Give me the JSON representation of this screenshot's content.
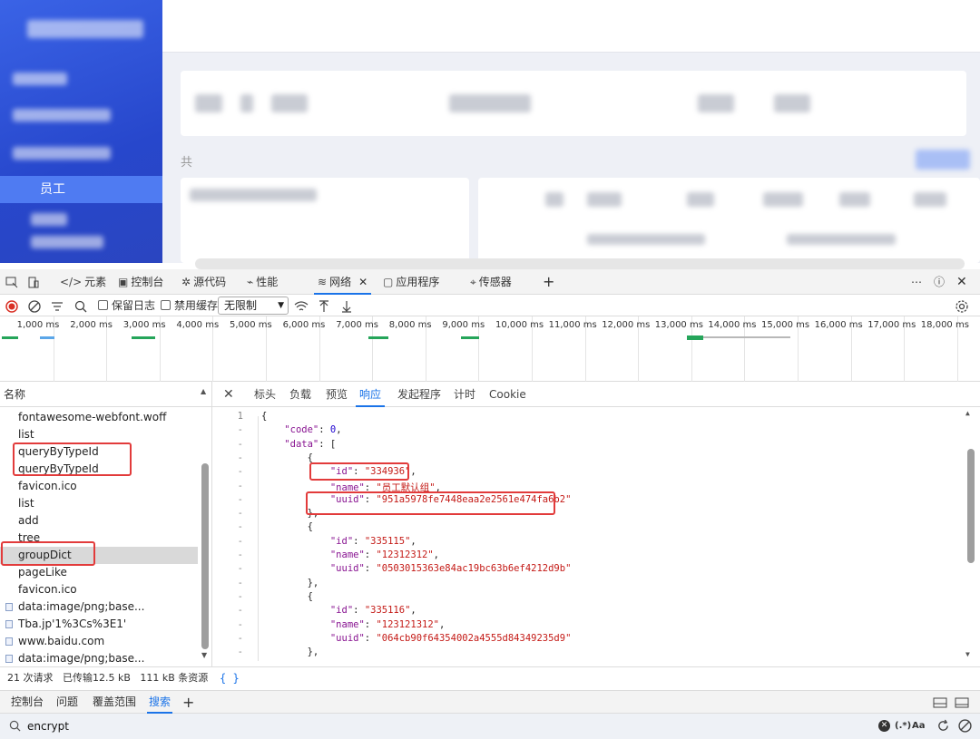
{
  "app": {
    "sidebar_active_item": "员工",
    "list_prefix": "共"
  },
  "devtools": {
    "tabs": [
      {
        "label": "元素",
        "icon": "code-icon"
      },
      {
        "label": "控制台",
        "icon": "console-icon"
      },
      {
        "label": "源代码",
        "icon": "bug-icon"
      },
      {
        "label": "性能",
        "icon": "performance-icon"
      },
      {
        "label": "网络",
        "icon": "wifi-icon"
      },
      {
        "label": "应用程序",
        "icon": "application-icon"
      },
      {
        "label": "传感器",
        "icon": "sensor-icon"
      }
    ],
    "active_tab": "网络",
    "toolbar": {
      "preserve_log": "保留日志",
      "disable_cache": "禁用缓存",
      "throttle": "无限制"
    },
    "timeline_ticks": [
      "1,000 ms",
      "2,000 ms",
      "3,000 ms",
      "4,000 ms",
      "5,000 ms",
      "6,000 ms",
      "7,000 ms",
      "8,000 ms",
      "9,000 ms",
      "10,000 ms",
      "11,000 ms",
      "12,000 ms",
      "13,000 ms",
      "14,000 ms",
      "15,000 ms",
      "16,000 ms",
      "17,000 ms",
      "18,000 ms"
    ],
    "request_list": {
      "header": "名称",
      "rows": [
        "fontawesome-webfont.woff",
        "list",
        "queryByTypeId",
        "queryByTypeId",
        "favicon.ico",
        "list",
        "add",
        "tree",
        "groupDict",
        "pageLike",
        "favicon.ico",
        "data:image/png;base...",
        "Tba.jp'1%3Cs%3E1'",
        "www.baidu.com",
        "data:image/png;base..."
      ],
      "selected_index": 8
    },
    "status": {
      "requests": "21 次请求",
      "transferred": "已传输12.5 kB",
      "resources": "111 kB 条资源"
    },
    "detail_tabs": [
      "标头",
      "负载",
      "预览",
      "响应",
      "发起程序",
      "计时",
      "Cookie"
    ],
    "detail_active": "响应",
    "response_lines": [
      {
        "ln": "1",
        "text": "{"
      },
      {
        "ln": "-",
        "text": "    \"code\": 0,"
      },
      {
        "ln": "-",
        "text": "    \"data\": ["
      },
      {
        "ln": "-",
        "text": "        {"
      },
      {
        "ln": "-",
        "text": "            \"id\": \"334936\","
      },
      {
        "ln": "-",
        "text": "            \"name\": \"员工默认组\","
      },
      {
        "ln": "-",
        "text": "            \"uuid\": \"951a5978fe7448eaa2e2561e474fa6b2\""
      },
      {
        "ln": "-",
        "text": "        },"
      },
      {
        "ln": "-",
        "text": "        {"
      },
      {
        "ln": "-",
        "text": "            \"id\": \"335115\","
      },
      {
        "ln": "-",
        "text": "            \"name\": \"12312312\","
      },
      {
        "ln": "-",
        "text": "            \"uuid\": \"0503015363e84ac19bc63b6ef4212d9b\""
      },
      {
        "ln": "-",
        "text": "        },"
      },
      {
        "ln": "-",
        "text": "        {"
      },
      {
        "ln": "-",
        "text": "            \"id\": \"335116\","
      },
      {
        "ln": "-",
        "text": "            \"name\": \"123121312\","
      },
      {
        "ln": "-",
        "text": "            \"uuid\": \"064cb90f64354002a4555d84349235d9\""
      },
      {
        "ln": "-",
        "text": "        },"
      }
    ],
    "braces_label": "{ }",
    "drawer_tabs": [
      "控制台",
      "问题",
      "覆盖范围",
      "搜索"
    ],
    "drawer_active": "搜索",
    "search": {
      "query": "encrypt",
      "regex_label": "(.*)",
      "case_label": "Aa"
    },
    "colors": {
      "accent": "#1a73e8",
      "highlight": "#e23b3b",
      "record": "#d93025"
    }
  }
}
